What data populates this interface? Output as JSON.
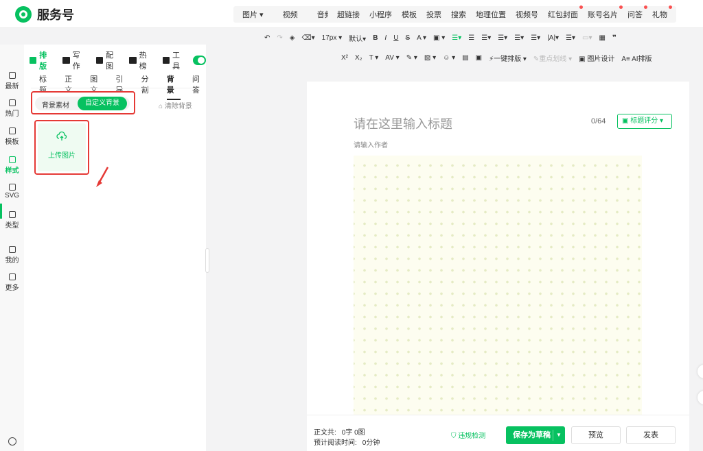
{
  "app": {
    "name": "服务号"
  },
  "topbar": {
    "media": [
      "图片",
      "视频",
      "音频"
    ],
    "insert": [
      {
        "label": "超链接",
        "dot": false
      },
      {
        "label": "小程序",
        "dot": false
      },
      {
        "label": "模板",
        "dot": false
      },
      {
        "label": "投票",
        "dot": false
      },
      {
        "label": "搜索",
        "dot": false
      },
      {
        "label": "地理位置",
        "dot": false
      },
      {
        "label": "视频号",
        "dot": false
      },
      {
        "label": "红包封面",
        "dot": true
      },
      {
        "label": "账号名片",
        "dot": true
      },
      {
        "label": "问答",
        "dot": true
      },
      {
        "label": "礼物",
        "dot": true
      }
    ]
  },
  "format_bar": {
    "font_size": "17px",
    "font_family": "默认",
    "row2_labels": {
      "one_click": "一键排版",
      "highlight": "重点划线",
      "image_design": "图片设计",
      "ai_layout": "AI排版"
    }
  },
  "sidenav": [
    {
      "label": "最新"
    },
    {
      "label": "热门"
    },
    {
      "label": "模板"
    },
    {
      "label": "样式",
      "active": true
    },
    {
      "label": "SVG"
    },
    {
      "label": "类型"
    },
    {
      "label": "我的"
    },
    {
      "label": "更多"
    }
  ],
  "panel": {
    "tabs": [
      {
        "label": "排版",
        "active": true
      },
      {
        "label": "写作"
      },
      {
        "label": "配图"
      },
      {
        "label": "热榜"
      },
      {
        "label": "工具"
      }
    ],
    "subtabs": [
      {
        "label": "标题"
      },
      {
        "label": "正文"
      },
      {
        "label": "图文"
      },
      {
        "label": "引导"
      },
      {
        "label": "分割"
      },
      {
        "label": "背景",
        "active": true
      },
      {
        "label": "问答"
      }
    ],
    "seg_a": "背景素材",
    "seg_b": "自定义背景",
    "clear": "清除背景",
    "upload": "上传图片"
  },
  "editor": {
    "title_placeholder": "请在这里输入标题",
    "count": "0/64",
    "score": "标题评分",
    "author_placeholder": "请输入作者"
  },
  "footer": {
    "text_label": "正文共:",
    "text_value": "0字 0图",
    "read_label": "预计阅读时间:",
    "read_value": "0分钟",
    "check": "违规检测",
    "save": "保存为草稿",
    "preview": "预览",
    "publish": "发表"
  },
  "colors": {
    "accent": "#07c160",
    "highlight": "#e53935"
  }
}
